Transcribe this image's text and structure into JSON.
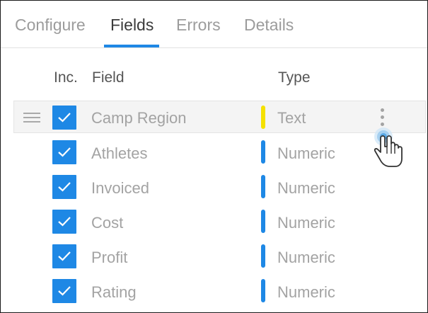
{
  "tabs": [
    {
      "label": "Configure",
      "active": false
    },
    {
      "label": "Fields",
      "active": true
    },
    {
      "label": "Errors",
      "active": false
    },
    {
      "label": "Details",
      "active": false
    }
  ],
  "columns": {
    "inc": "Inc.",
    "field": "Field",
    "type": "Type"
  },
  "fields": [
    {
      "name": "Camp Region",
      "type": "Text",
      "type_color": "#f5e100",
      "included": true
    },
    {
      "name": "Athletes",
      "type": "Numeric",
      "type_color": "#1e88e5",
      "included": true
    },
    {
      "name": "Invoiced",
      "type": "Numeric",
      "type_color": "#1e88e5",
      "included": true
    },
    {
      "name": "Cost",
      "type": "Numeric",
      "type_color": "#1e88e5",
      "included": true
    },
    {
      "name": "Profit",
      "type": "Numeric",
      "type_color": "#1e88e5",
      "included": true
    },
    {
      "name": "Rating",
      "type": "Numeric",
      "type_color": "#1e88e5",
      "included": true
    }
  ],
  "icons": {
    "drag": "drag-handle-icon",
    "checkbox": "checkmark-icon",
    "menu": "more-vertical-icon",
    "cursor": "hand-pointer-icon"
  },
  "colors": {
    "accent": "#1e88e5",
    "text_type": "#f5e100"
  }
}
